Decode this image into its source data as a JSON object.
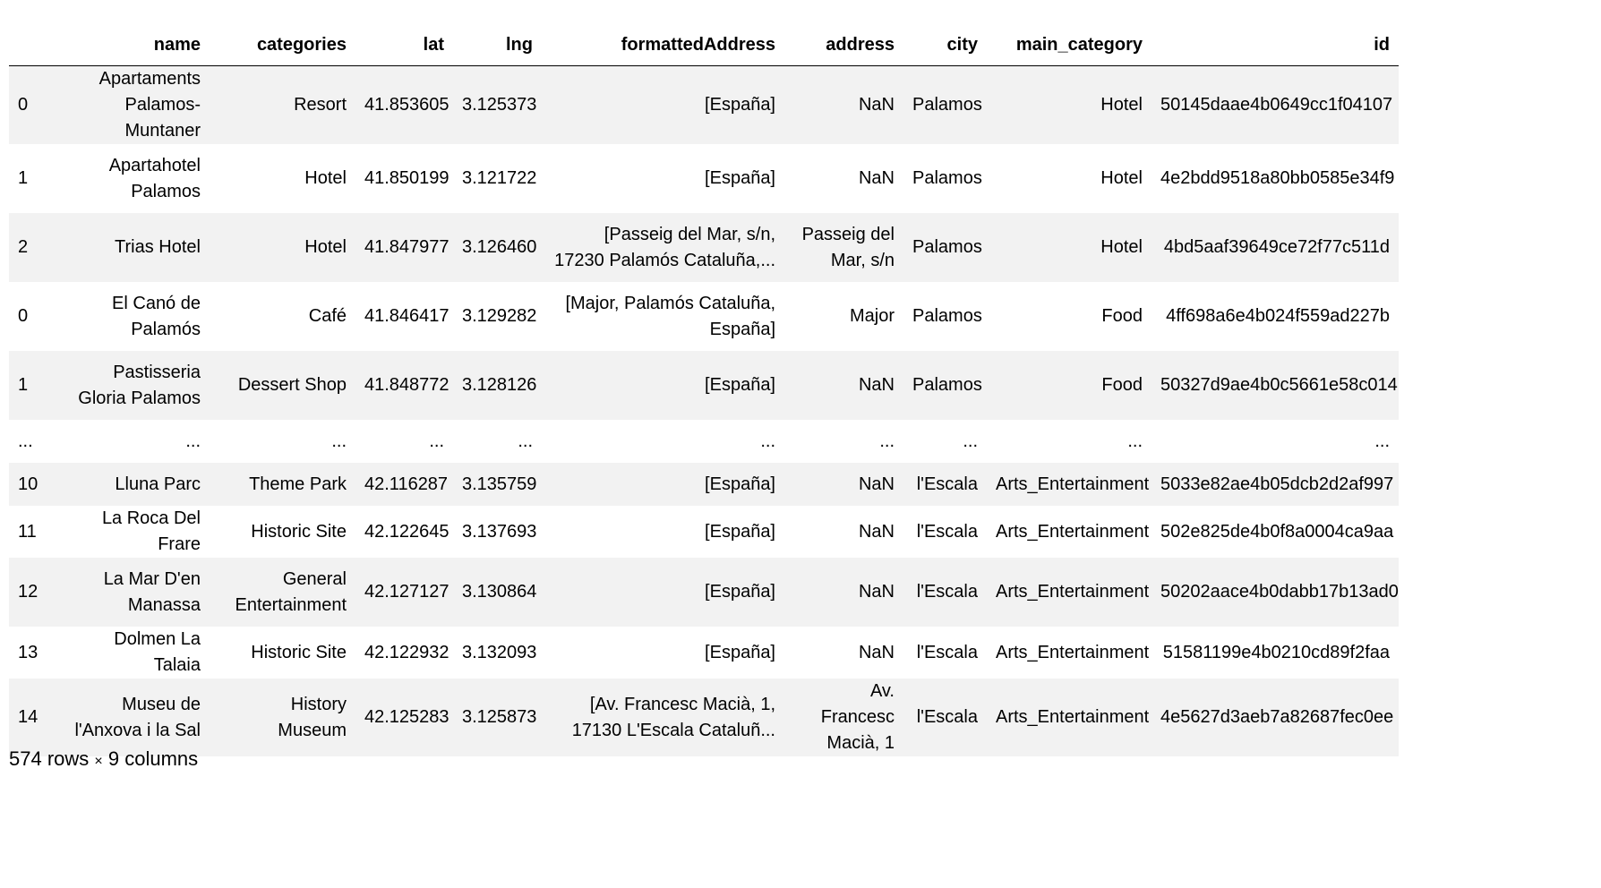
{
  "table": {
    "columns": [
      "name",
      "categories",
      "lat",
      "lng",
      "formattedAddress",
      "address",
      "city",
      "main_category",
      "id"
    ],
    "rows": [
      {
        "index": "0",
        "name": "Apartaments Palamos-Muntaner",
        "categories": "Resort",
        "lat": "41.853605",
        "lng": "3.125373",
        "formattedAddress": "[España]",
        "address": "NaN",
        "city": "Palamos",
        "main_category": "Hotel",
        "id": "50145daae4b0649cc1f04107"
      },
      {
        "index": "1",
        "name": "Apartahotel Palamos",
        "categories": "Hotel",
        "lat": "41.850199",
        "lng": "3.121722",
        "formattedAddress": "[España]",
        "address": "NaN",
        "city": "Palamos",
        "main_category": "Hotel",
        "id": "4e2bdd9518a80bb0585e34f9"
      },
      {
        "index": "2",
        "name": "Trias Hotel",
        "categories": "Hotel",
        "lat": "41.847977",
        "lng": "3.126460",
        "formattedAddress": "[Passeig del Mar, s/n, 17230 Palamós Cataluña,...",
        "address": "Passeig del Mar, s/n",
        "city": "Palamos",
        "main_category": "Hotel",
        "id": "4bd5aaf39649ce72f77c511d"
      },
      {
        "index": "0",
        "name": "El Canó de Palamós",
        "categories": "Café",
        "lat": "41.846417",
        "lng": "3.129282",
        "formattedAddress": "[Major, Palamós Cataluña, España]",
        "address": "Major",
        "city": "Palamos",
        "main_category": "Food",
        "id": "4ff698a6e4b024f559ad227b"
      },
      {
        "index": "1",
        "name": "Pastisseria Gloria Palamos",
        "categories": "Dessert Shop",
        "lat": "41.848772",
        "lng": "3.128126",
        "formattedAddress": "[España]",
        "address": "NaN",
        "city": "Palamos",
        "main_category": "Food",
        "id": "50327d9ae4b0c5661e58c014"
      },
      {
        "index": "...",
        "name": "...",
        "categories": "...",
        "lat": "...",
        "lng": "...",
        "formattedAddress": "...",
        "address": "...",
        "city": "...",
        "main_category": "...",
        "id": "..."
      },
      {
        "index": "10",
        "name": "Lluna Parc",
        "categories": "Theme Park",
        "lat": "42.116287",
        "lng": "3.135759",
        "formattedAddress": "[España]",
        "address": "NaN",
        "city": "l'Escala",
        "main_category": "Arts_Entertainment",
        "id": "5033e82ae4b05dcb2d2af997"
      },
      {
        "index": "11",
        "name": "La Roca Del Frare",
        "categories": "Historic Site",
        "lat": "42.122645",
        "lng": "3.137693",
        "formattedAddress": "[España]",
        "address": "NaN",
        "city": "l'Escala",
        "main_category": "Arts_Entertainment",
        "id": "502e825de4b0f8a0004ca9aa"
      },
      {
        "index": "12",
        "name": "La Mar D'en Manassa",
        "categories": "General Entertainment",
        "lat": "42.127127",
        "lng": "3.130864",
        "formattedAddress": "[España]",
        "address": "NaN",
        "city": "l'Escala",
        "main_category": "Arts_Entertainment",
        "id": "50202aace4b0dabb17b13ad0"
      },
      {
        "index": "13",
        "name": "Dolmen La Talaia",
        "categories": "Historic Site",
        "lat": "42.122932",
        "lng": "3.132093",
        "formattedAddress": "[España]",
        "address": "NaN",
        "city": "l'Escala",
        "main_category": "Arts_Entertainment",
        "id": "51581199e4b0210cd89f2faa"
      },
      {
        "index": "14",
        "name": "Museu de l'Anxova i la Sal",
        "categories": "History Museum",
        "lat": "42.125283",
        "lng": "3.125873",
        "formattedAddress": "[Av. Francesc Macià, 1, 17130 L'Escala Cataluñ...",
        "address": "Av. Francesc Macià, 1",
        "city": "l'Escala",
        "main_category": "Arts_Entertainment",
        "id": "4e5627d3aeb7a82687fec0ee"
      }
    ]
  },
  "footer": {
    "rows_count": "574 rows",
    "times": "×",
    "cols_count": "9 columns"
  }
}
